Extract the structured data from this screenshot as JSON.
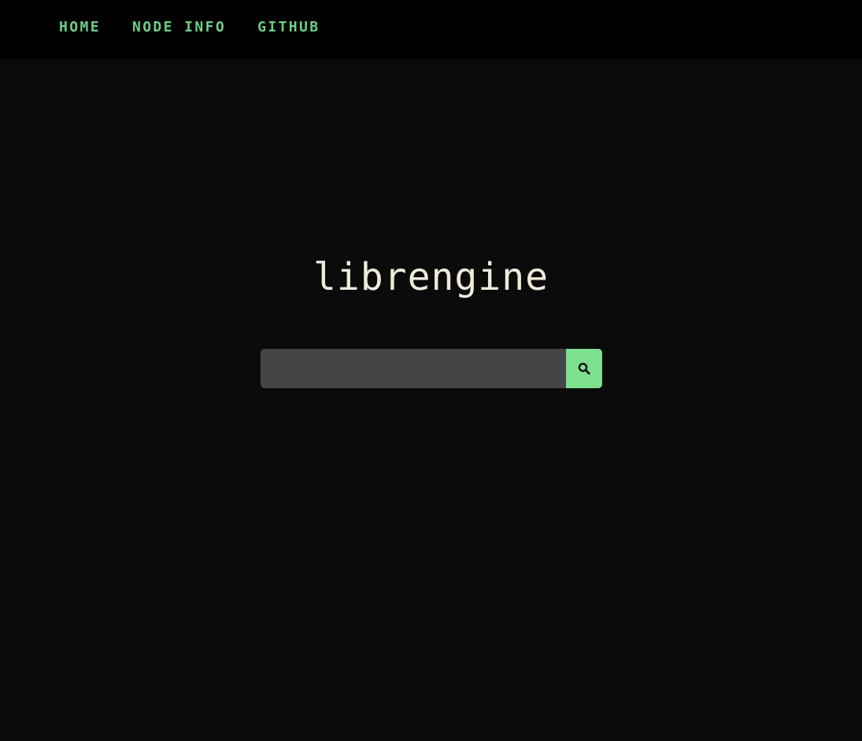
{
  "nav": {
    "items": [
      {
        "label": "HOME"
      },
      {
        "label": "NODE INFO"
      },
      {
        "label": "GITHUB"
      }
    ]
  },
  "logo": {
    "text": "librengine"
  },
  "search": {
    "value": "",
    "placeholder": "",
    "button_icon": "search-icon"
  },
  "colors": {
    "nav_background": "#000000",
    "page_background": "#0b0b0b",
    "accent_green": "#7de08f",
    "nav_link": "#6fce85",
    "logo_text": "#f1eadc",
    "input_background": "#454545"
  }
}
